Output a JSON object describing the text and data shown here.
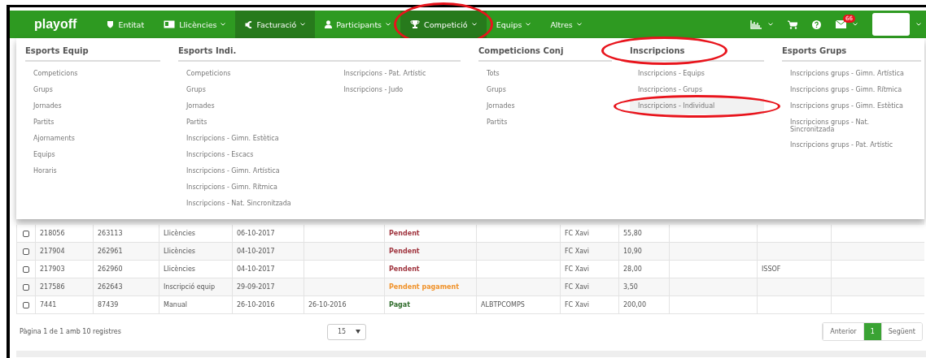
{
  "nav": {
    "brand": "playoff",
    "items": [
      {
        "label": "Entitat",
        "caret": false,
        "highlighted": false,
        "circled": false
      },
      {
        "label": "Llicències",
        "caret": true,
        "highlighted": false,
        "circled": false
      },
      {
        "label": "Facturació",
        "caret": true,
        "highlighted": true,
        "circled": false
      },
      {
        "label": "Participants",
        "caret": true,
        "highlighted": false,
        "circled": false
      },
      {
        "label": "Competició",
        "caret": true,
        "highlighted": true,
        "circled": true
      },
      {
        "label": "Equips",
        "caret": true,
        "highlighted": false,
        "circled": false
      },
      {
        "label": "Altres",
        "caret": true,
        "highlighted": false,
        "circled": false
      }
    ],
    "mail_badge": "66"
  },
  "menu": [
    {
      "heading": "Esports Equip",
      "circled": false,
      "lists": [
        [
          {
            "label": "Competicions",
            "selected": false,
            "circled": false
          },
          {
            "label": "Grups",
            "selected": false,
            "circled": false
          },
          {
            "label": "Jornades",
            "selected": false,
            "circled": false
          },
          {
            "label": "Partits",
            "selected": false,
            "circled": false
          },
          {
            "label": "Ajornaments",
            "selected": false,
            "circled": false
          },
          {
            "label": "Equips",
            "selected": false,
            "circled": false
          },
          {
            "label": "Horaris",
            "selected": false,
            "circled": false
          }
        ]
      ]
    },
    {
      "heading": "Esports Indi.",
      "circled": false,
      "lists": [
        [
          {
            "label": "Competicions",
            "selected": false,
            "circled": false
          },
          {
            "label": "Grups",
            "selected": false,
            "circled": false
          },
          {
            "label": "Jornades",
            "selected": false,
            "circled": false
          },
          {
            "label": "Partits",
            "selected": false,
            "circled": false
          },
          {
            "label": "Inscripcions - Gimn. Estètica",
            "selected": false,
            "circled": false
          },
          {
            "label": "Inscripcions - Escacs",
            "selected": false,
            "circled": false
          },
          {
            "label": "Inscripcions - Gimn. Artística",
            "selected": false,
            "circled": false
          },
          {
            "label": "Inscripcions - Gimn. Rítmica",
            "selected": false,
            "circled": false
          },
          {
            "label": "Inscripcions - Nat. Sincronitzada",
            "selected": false,
            "circled": false
          }
        ],
        [
          {
            "label": "Inscripcions - Pat. Artístic",
            "selected": false,
            "circled": false
          },
          {
            "label": "Inscripcions - Judo",
            "selected": false,
            "circled": false
          }
        ]
      ]
    },
    {
      "heading": "Competicions Conj",
      "circled": false,
      "lists": [
        [
          {
            "label": "Tots",
            "selected": false,
            "circled": false
          },
          {
            "label": "Grups",
            "selected": false,
            "circled": false
          },
          {
            "label": "Jornades",
            "selected": false,
            "circled": false
          },
          {
            "label": "Partits",
            "selected": false,
            "circled": false
          }
        ]
      ]
    },
    {
      "heading": "Inscripcions",
      "circled": true,
      "lists": [
        [
          {
            "label": "Inscripcions - Equips",
            "selected": false,
            "circled": false
          },
          {
            "label": "Inscripcions - Grups",
            "selected": false,
            "circled": false
          },
          {
            "label": "Inscripcions - Individual",
            "selected": true,
            "circled": true
          }
        ]
      ]
    },
    {
      "heading": "Esports Grups",
      "circled": false,
      "lists": [
        [
          {
            "label": "Inscripcions grups - Gimn. Artística",
            "selected": false,
            "circled": false
          },
          {
            "label": "Inscripcions grups - Gimn. Rítmica",
            "selected": false,
            "circled": false
          },
          {
            "label": "Inscripcions grups - Gimn. Estètica",
            "selected": false,
            "circled": false
          },
          {
            "label": "Inscripcions grups - Nat. Sincronitzada",
            "selected": false,
            "circled": false
          },
          {
            "label": "Inscripcions grups - Pat. Artístic",
            "selected": false,
            "circled": false
          }
        ]
      ]
    }
  ],
  "table": {
    "rows": [
      {
        "checked": false,
        "cells": [
          "218056",
          "263113",
          "Llicències",
          "06-10-2017",
          "",
          "Pendent",
          "",
          "FC Xavi",
          "55,80",
          "",
          "",
          ""
        ],
        "color": "#a0353f"
      },
      {
        "checked": false,
        "cells": [
          "217904",
          "262961",
          "Llicències",
          "04-10-2017",
          "",
          "Pendent",
          "",
          "FC Xavi",
          "10,90",
          "",
          "",
          ""
        ],
        "color": "#a0353f"
      },
      {
        "checked": false,
        "cells": [
          "217903",
          "262960",
          "Llicències",
          "04-10-2017",
          "",
          "Pendent",
          "",
          "FC Xavi",
          "28,00",
          "",
          "ISSOF",
          ""
        ],
        "color": "#a0353f"
      },
      {
        "checked": false,
        "cells": [
          "217586",
          "262643",
          "Inscripció equip",
          "29-09-2017",
          "",
          "Pendent pagament",
          "",
          "FC Xavi",
          "3,50",
          "",
          "",
          ""
        ],
        "color": "#f0922a"
      },
      {
        "checked": false,
        "cells": [
          "7441",
          "87439",
          "Manual",
          "26-10-2016",
          "26-10-2016",
          "Pagat",
          "ALBTPCOMPS",
          "FC Xavi",
          "200,00",
          "",
          "",
          ""
        ],
        "color": "#2e6b2a"
      }
    ]
  },
  "footer": {
    "summary": "Pàgina 1 de 1 amb 10 registres",
    "page_size": "15",
    "pages": [
      {
        "label": "Anterior",
        "selected": false
      },
      {
        "label": "1",
        "selected": true
      },
      {
        "label": "Següent",
        "selected": false
      }
    ]
  }
}
